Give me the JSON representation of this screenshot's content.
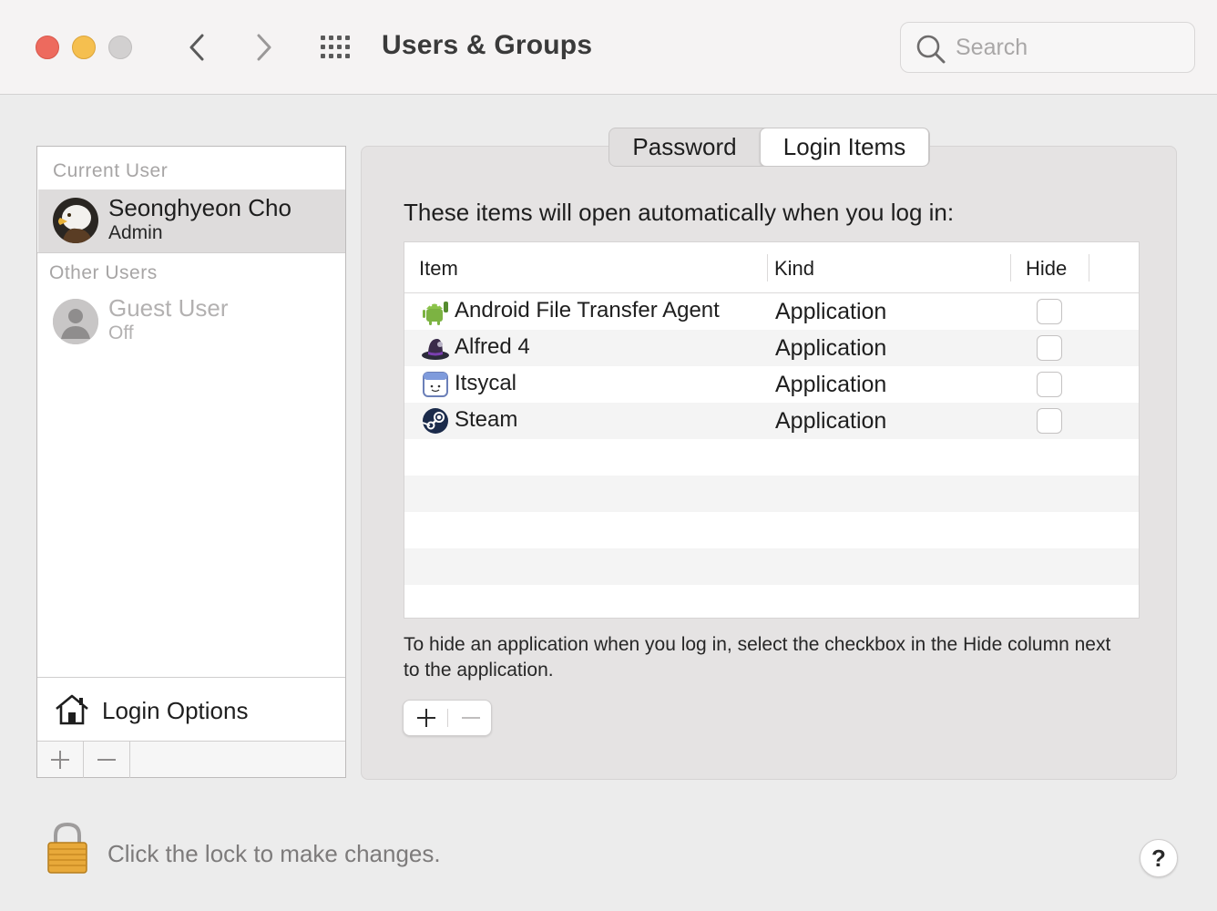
{
  "window": {
    "title": "Users & Groups",
    "search_placeholder": "Search"
  },
  "sidebar": {
    "current_user_label": "Current User",
    "current_user": {
      "name": "Seonghyeon Cho",
      "role": "Admin"
    },
    "other_users_label": "Other Users",
    "other_users": [
      {
        "name": "Guest User",
        "status": "Off"
      }
    ],
    "login_options_label": "Login Options",
    "add_symbol": "+",
    "remove_symbol": "—"
  },
  "tabs": [
    {
      "label": "Password",
      "selected": false
    },
    {
      "label": "Login Items",
      "selected": true
    }
  ],
  "login_items": {
    "intro": "These items will open automatically when you log in:",
    "columns": {
      "item": "Item",
      "kind": "Kind",
      "hide": "Hide"
    },
    "rows": [
      {
        "name": "Android File Transfer Agent",
        "kind": "Application",
        "hide": false,
        "icon": "android-icon"
      },
      {
        "name": "Alfred 4",
        "kind": "Application",
        "hide": false,
        "icon": "alfred-icon"
      },
      {
        "name": "Itsycal",
        "kind": "Application",
        "hide": false,
        "icon": "itsycal-icon"
      },
      {
        "name": "Steam",
        "kind": "Application",
        "hide": false,
        "icon": "steam-icon"
      }
    ],
    "hint": "To hide an application when you log in, select the checkbox in the Hide column next to the application.",
    "add_symbol": "+",
    "remove_symbol": "—"
  },
  "footer": {
    "lock_text": "Click the lock to make changes.",
    "help_symbol": "?"
  },
  "colors": {
    "close": "#ed6a5e",
    "minimize": "#f5bf4f",
    "zoom_disabled": "#d2d0d0"
  }
}
